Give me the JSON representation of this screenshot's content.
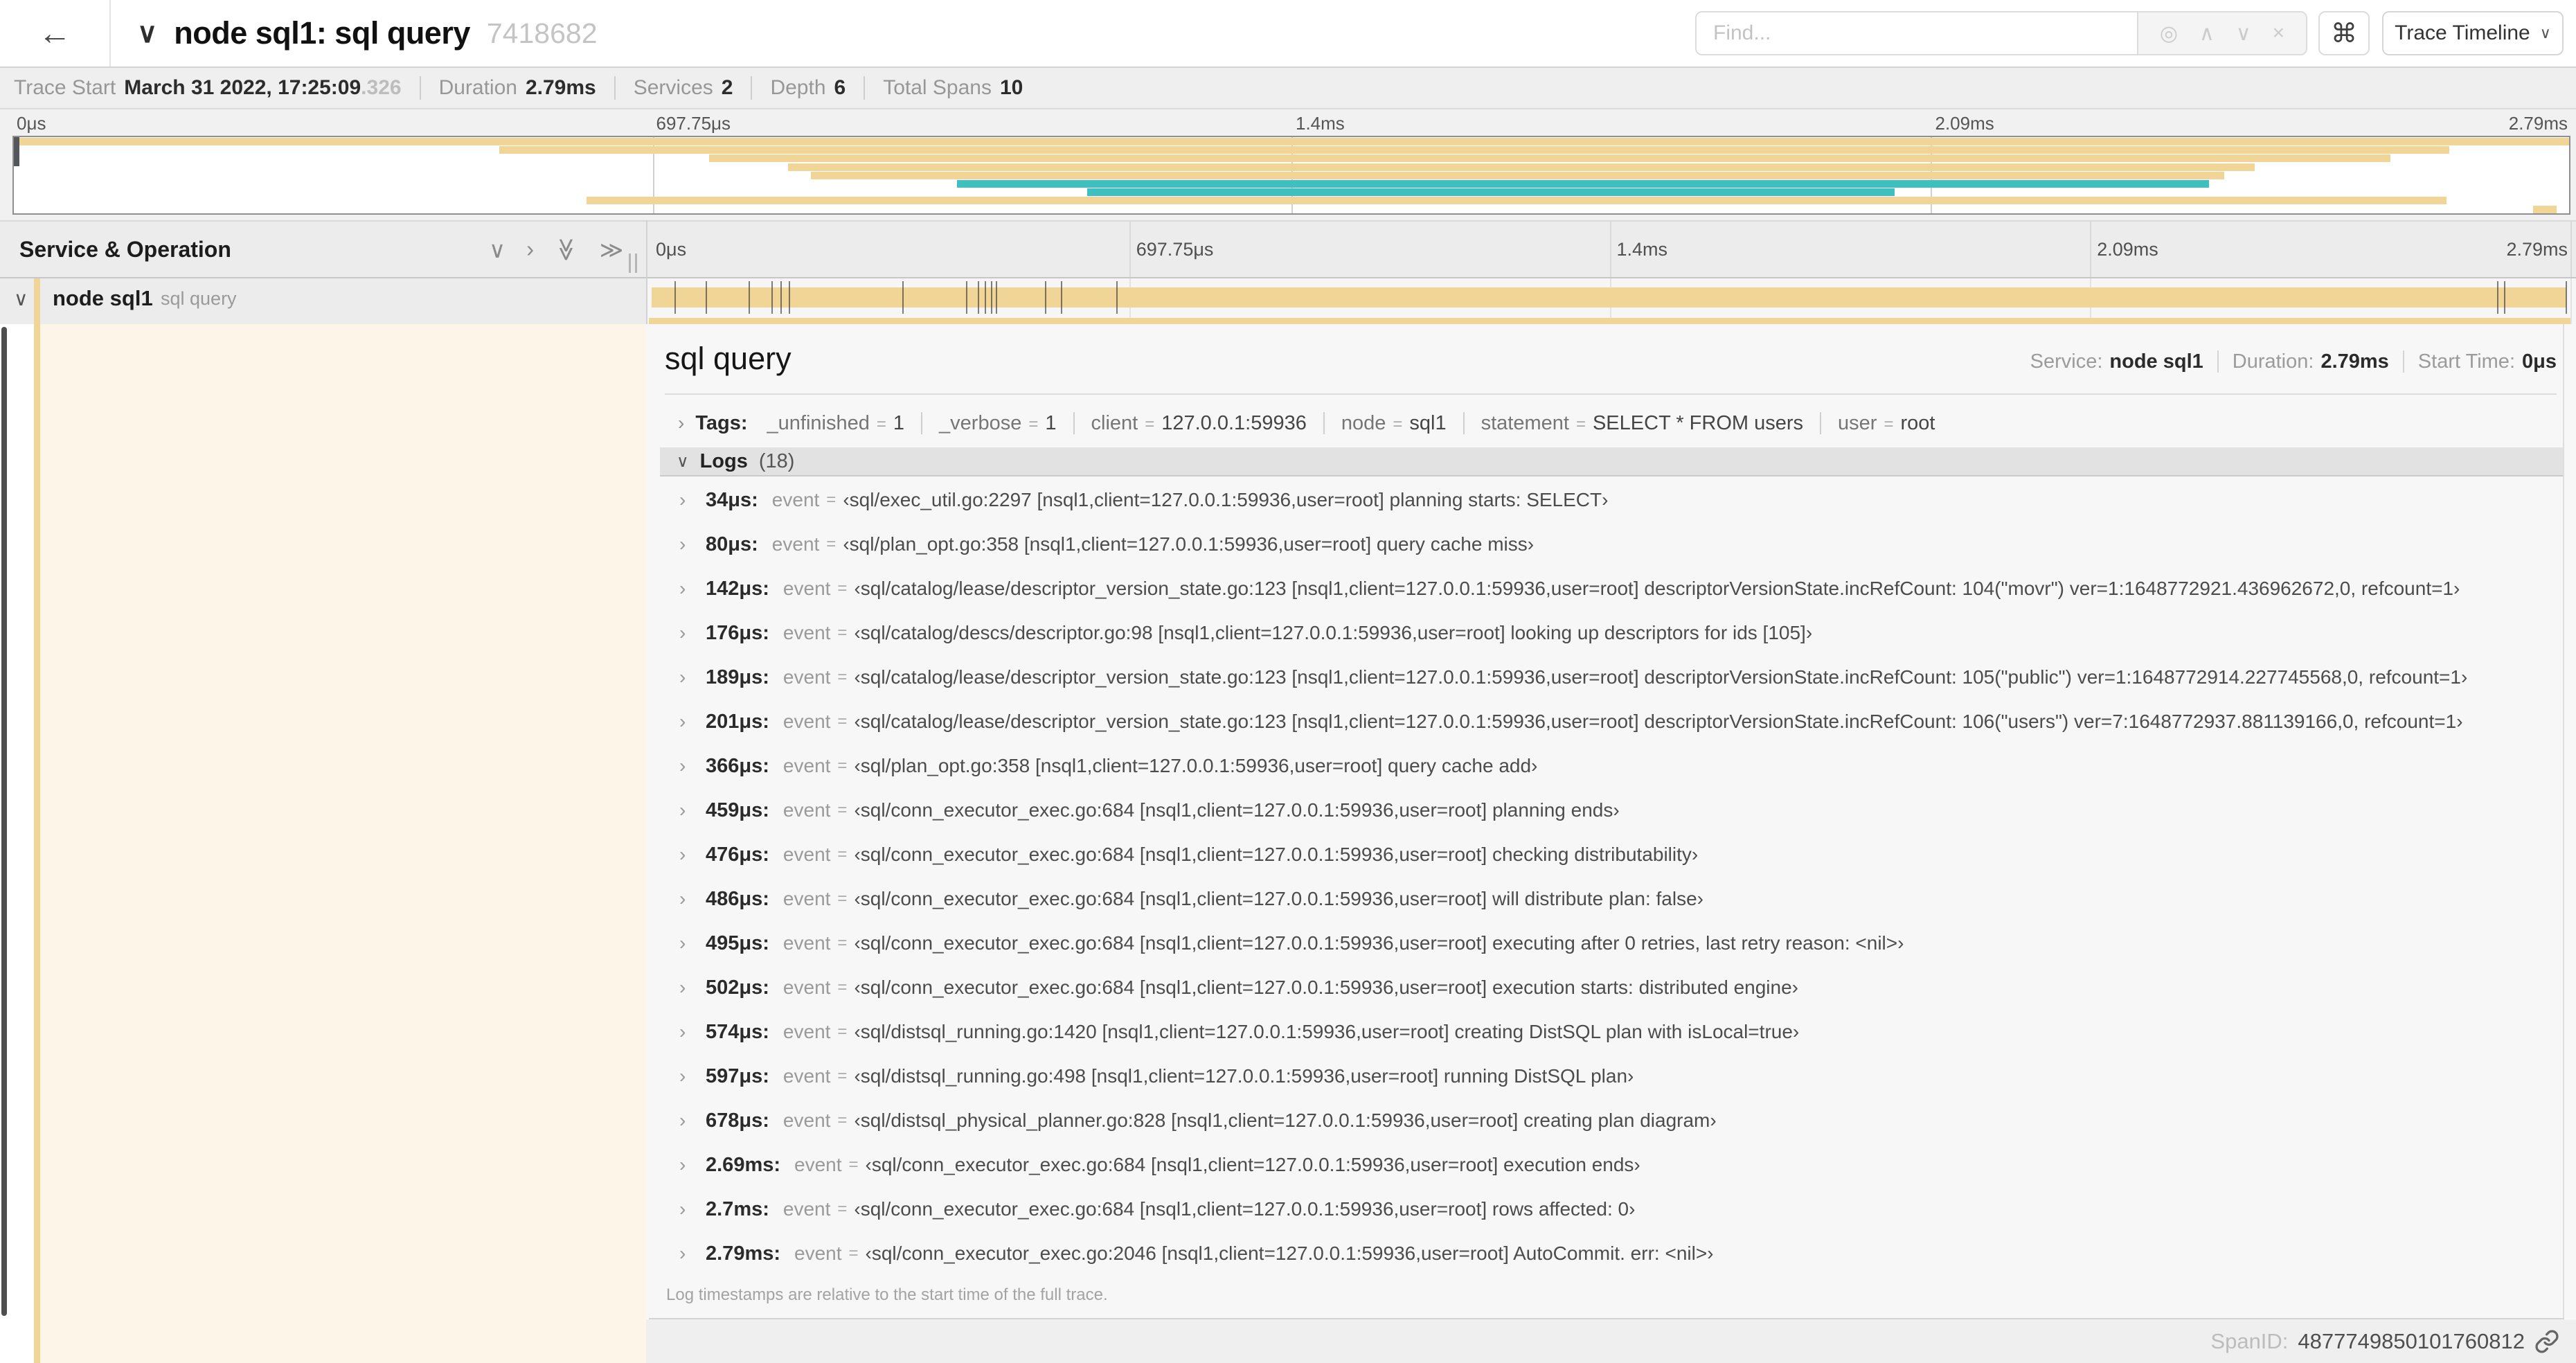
{
  "colors": {
    "tan": "#f1d597",
    "teal": "#3fc0c0",
    "cream": "#fdf5e7"
  },
  "icons": {
    "back": "←",
    "chevron_down": "∨",
    "chevron_up": "∧",
    "chevron_right": "›",
    "double_chevron_down": "≫",
    "double_chevron_right": "≫",
    "close": "×",
    "command": "⌘",
    "target": "◎",
    "equals": "="
  },
  "header": {
    "title": "node sql1: sql query",
    "trace_id": "7418682",
    "find_placeholder": "Find...",
    "view_button": "Trace Timeline"
  },
  "summary": {
    "items": [
      {
        "label": "Trace Start",
        "value": "March 31 2022, 17:25:09",
        "suffix": ".326"
      },
      {
        "label": "Duration",
        "value": "2.79ms"
      },
      {
        "label": "Services",
        "value": "2"
      },
      {
        "label": "Depth",
        "value": "6"
      },
      {
        "label": "Total Spans",
        "value": "10"
      }
    ]
  },
  "timeline": {
    "left_header": "Service & Operation",
    "ticks": [
      "0μs",
      "697.75μs",
      "1.4ms",
      "2.09ms",
      "2.79ms"
    ],
    "total_us": 2790,
    "log_ticks_us": [
      34,
      80,
      142,
      176,
      189,
      201,
      366,
      459,
      476,
      486,
      495,
      502,
      574,
      597,
      678,
      2690,
      2700,
      2790
    ]
  },
  "minimap": {
    "bars": [
      {
        "row": 0,
        "start": 0,
        "end": 1,
        "color": "tan"
      },
      {
        "row": 1,
        "start": 0.19,
        "end": 0.953,
        "color": "tan"
      },
      {
        "row": 2,
        "start": 0.272,
        "end": 0.93,
        "color": "tan"
      },
      {
        "row": 3,
        "start": 0.303,
        "end": 0.877,
        "color": "tan"
      },
      {
        "row": 4,
        "start": 0.312,
        "end": 0.865,
        "color": "tan"
      },
      {
        "row": 5,
        "start": 0.369,
        "end": 0.859,
        "color": "teal"
      },
      {
        "row": 6,
        "start": 0.42,
        "end": 0.736,
        "color": "teal"
      },
      {
        "row": 7,
        "start": 0.224,
        "end": 0.952,
        "color": "tan"
      },
      {
        "row": 8,
        "start": 0.986,
        "end": 0.995,
        "color": "tan"
      }
    ]
  },
  "span_row": {
    "service": "node sql1",
    "operation": "sql query"
  },
  "detail": {
    "title": "sql query",
    "service_label": "Service:",
    "service": "node sql1",
    "duration_label": "Duration:",
    "duration": "2.79ms",
    "start_label": "Start Time:",
    "start": "0μs",
    "tags_label": "Tags:",
    "tags": [
      {
        "key": "_unfinished",
        "value": "1"
      },
      {
        "key": "_verbose",
        "value": "1"
      },
      {
        "key": "client",
        "value": "127.0.0.1:59936"
      },
      {
        "key": "node",
        "value": "sql1"
      },
      {
        "key": "statement",
        "value": "SELECT * FROM users"
      },
      {
        "key": "user",
        "value": "root"
      }
    ],
    "logs_label": "Logs",
    "logs_count": "(18)",
    "logs_field_label": "event",
    "logs": [
      {
        "t": "34μs:",
        "value": "‹sql/exec_util.go:2297 [nsql1,client=127.0.0.1:59936,user=root] planning starts: SELECT›"
      },
      {
        "t": "80μs:",
        "value": "‹sql/plan_opt.go:358 [nsql1,client=127.0.0.1:59936,user=root] query cache miss›"
      },
      {
        "t": "142μs:",
        "value": "‹sql/catalog/lease/descriptor_version_state.go:123 [nsql1,client=127.0.0.1:59936,user=root] descriptorVersionState.incRefCount: 104(\"movr\") ver=1:1648772921.436962672,0, refcount=1›"
      },
      {
        "t": "176μs:",
        "value": "‹sql/catalog/descs/descriptor.go:98 [nsql1,client=127.0.0.1:59936,user=root] looking up descriptors for ids [105]›"
      },
      {
        "t": "189μs:",
        "value": "‹sql/catalog/lease/descriptor_version_state.go:123 [nsql1,client=127.0.0.1:59936,user=root] descriptorVersionState.incRefCount: 105(\"public\") ver=1:1648772914.227745568,0, refcount=1›"
      },
      {
        "t": "201μs:",
        "value": "‹sql/catalog/lease/descriptor_version_state.go:123 [nsql1,client=127.0.0.1:59936,user=root] descriptorVersionState.incRefCount: 106(\"users\") ver=7:1648772937.881139166,0, refcount=1›"
      },
      {
        "t": "366μs:",
        "value": "‹sql/plan_opt.go:358 [nsql1,client=127.0.0.1:59936,user=root] query cache add›"
      },
      {
        "t": "459μs:",
        "value": "‹sql/conn_executor_exec.go:684 [nsql1,client=127.0.0.1:59936,user=root] planning ends›"
      },
      {
        "t": "476μs:",
        "value": "‹sql/conn_executor_exec.go:684 [nsql1,client=127.0.0.1:59936,user=root] checking distributability›"
      },
      {
        "t": "486μs:",
        "value": "‹sql/conn_executor_exec.go:684 [nsql1,client=127.0.0.1:59936,user=root] will distribute plan: false›"
      },
      {
        "t": "495μs:",
        "value": "‹sql/conn_executor_exec.go:684 [nsql1,client=127.0.0.1:59936,user=root] executing after 0 retries, last retry reason: <nil>›"
      },
      {
        "t": "502μs:",
        "value": "‹sql/conn_executor_exec.go:684 [nsql1,client=127.0.0.1:59936,user=root] execution starts: distributed engine›"
      },
      {
        "t": "574μs:",
        "value": "‹sql/distsql_running.go:1420 [nsql1,client=127.0.0.1:59936,user=root] creating DistSQL plan with isLocal=true›"
      },
      {
        "t": "597μs:",
        "value": "‹sql/distsql_running.go:498 [nsql1,client=127.0.0.1:59936,user=root] running DistSQL plan›"
      },
      {
        "t": "678μs:",
        "value": "‹sql/distsql_physical_planner.go:828 [nsql1,client=127.0.0.1:59936,user=root] creating plan diagram›"
      },
      {
        "t": "2.69ms:",
        "value": "‹sql/conn_executor_exec.go:684 [nsql1,client=127.0.0.1:59936,user=root] execution ends›"
      },
      {
        "t": "2.7ms:",
        "value": "‹sql/conn_executor_exec.go:684 [nsql1,client=127.0.0.1:59936,user=root] rows affected: 0›"
      },
      {
        "t": "2.79ms:",
        "value": "‹sql/conn_executor_exec.go:2046 [nsql1,client=127.0.0.1:59936,user=root] AutoCommit. err: <nil>›"
      }
    ],
    "footer": "Log timestamps are relative to the start time of the full trace.",
    "spanid_label": "SpanID:",
    "spanid": "4877749850101760812"
  }
}
